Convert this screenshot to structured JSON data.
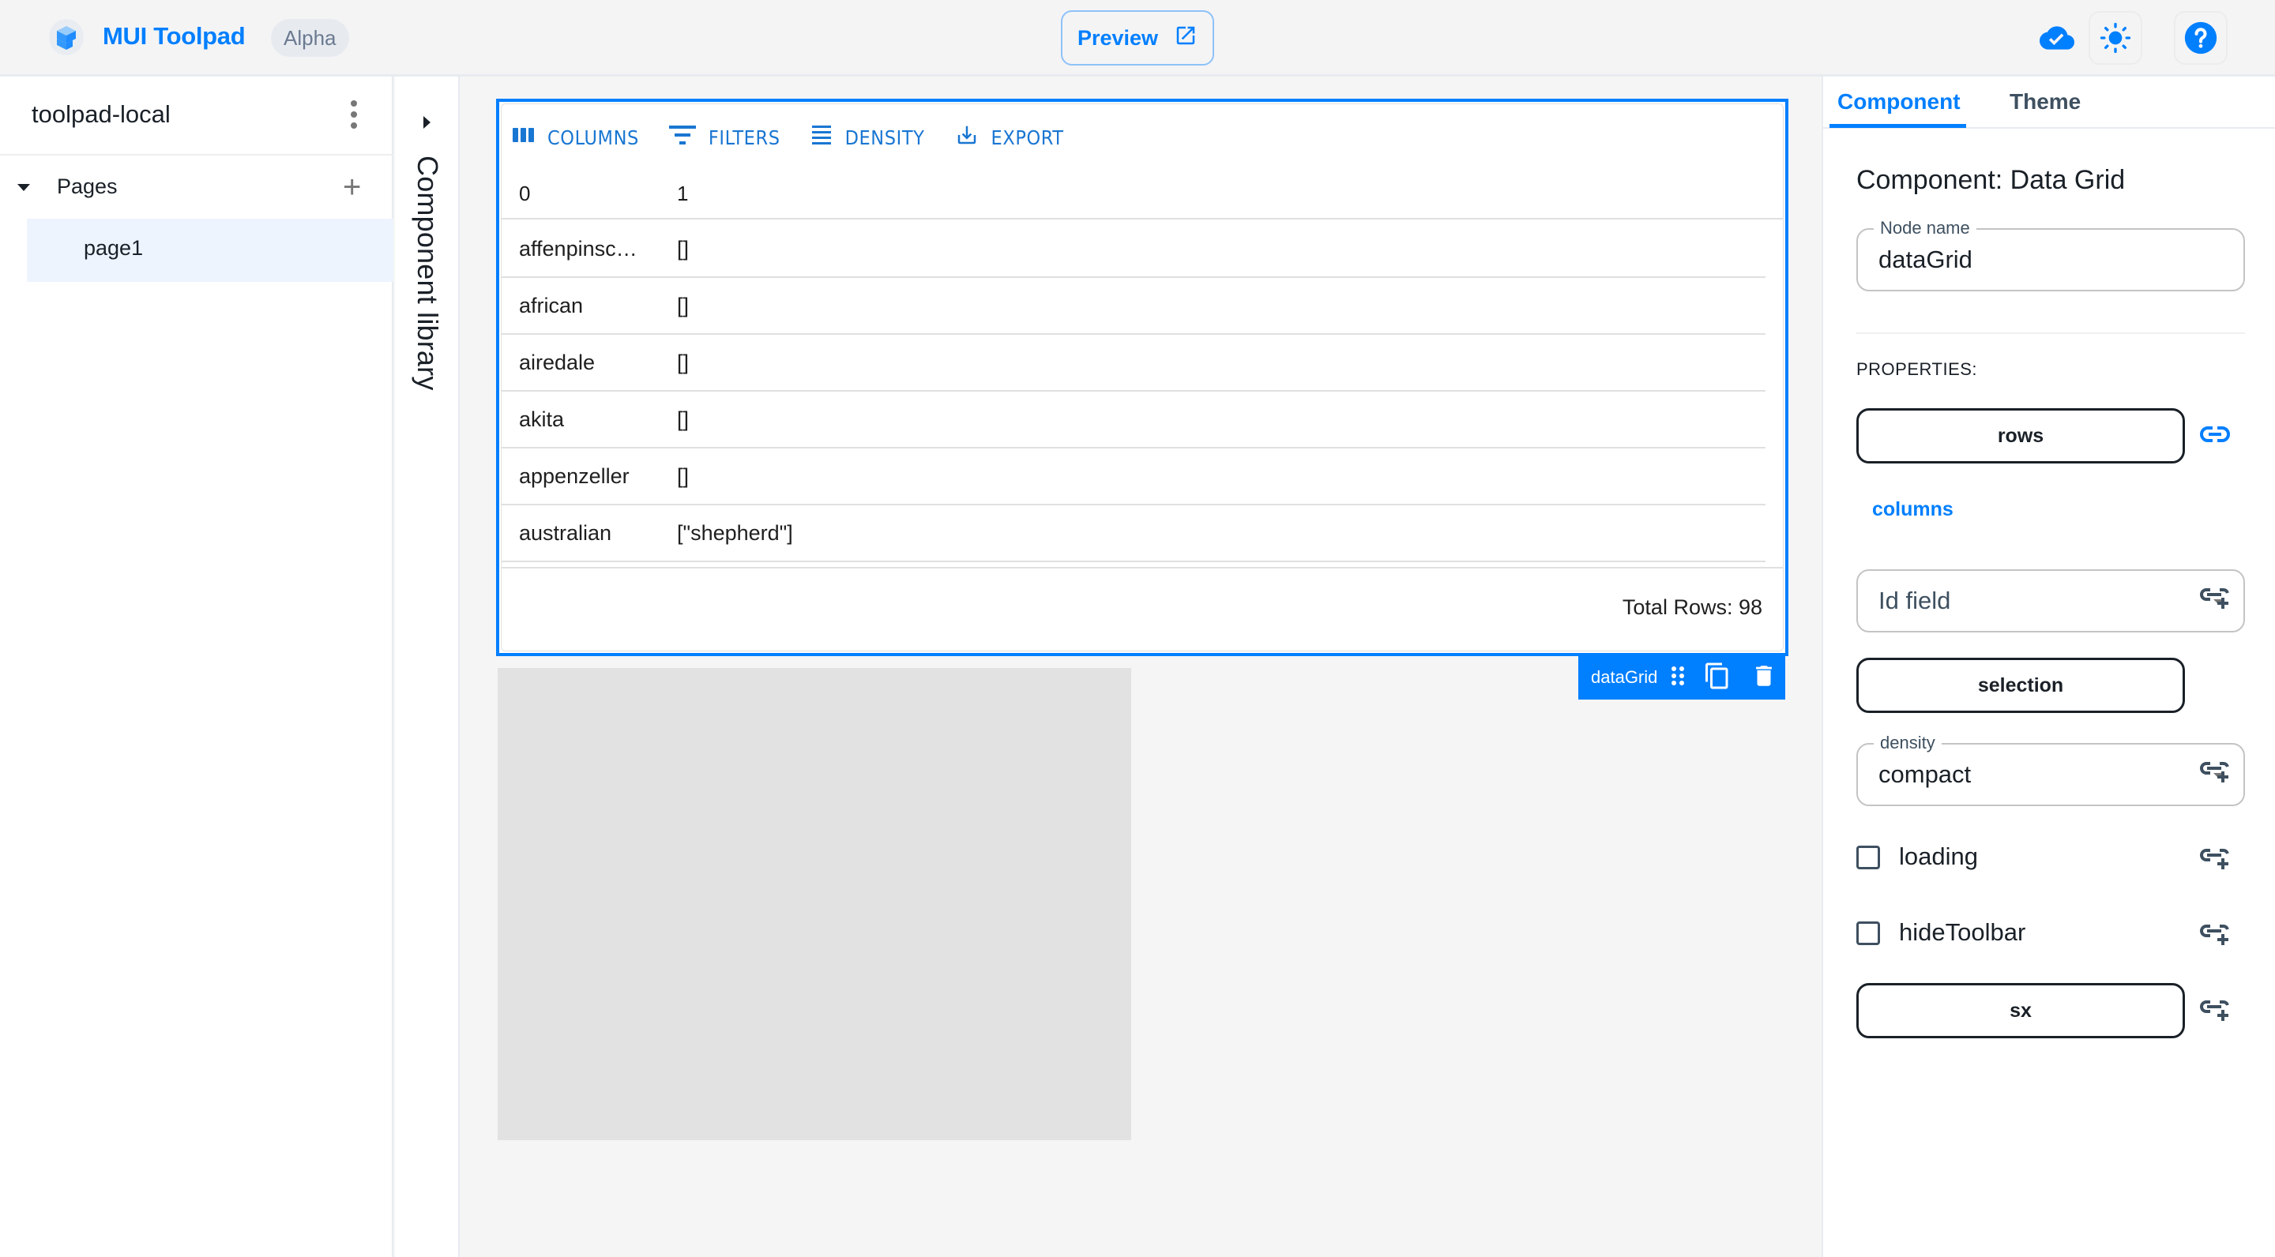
{
  "topbar": {
    "app_title": "MUI Toolpad",
    "badge": "Alpha",
    "preview_label": "Preview",
    "icons": [
      "toolpad-logo-icon",
      "cloud-done-icon",
      "light-mode-icon",
      "help-icon"
    ]
  },
  "sidebar": {
    "project_name": "toolpad-local",
    "pages_label": "Pages",
    "pages": [
      {
        "label": "page1",
        "selected": true
      }
    ]
  },
  "component_library": {
    "label": "Component library"
  },
  "canvas": {
    "data_grid": {
      "toolbar": [
        {
          "label": "COLUMNS",
          "icon": "view-column-icon"
        },
        {
          "label": "FILTERS",
          "icon": "filter-list-icon"
        },
        {
          "label": "DENSITY",
          "icon": "density-icon"
        },
        {
          "label": "EXPORT",
          "icon": "export-icon"
        }
      ],
      "columns": [
        "0",
        "1"
      ],
      "rows": [
        [
          "affenpinsc…",
          "[]"
        ],
        [
          "african",
          "[]"
        ],
        [
          "airedale",
          "[]"
        ],
        [
          "akita",
          "[]"
        ],
        [
          "appenzeller",
          "[]"
        ],
        [
          "australian",
          "[\"shepherd\"]"
        ]
      ],
      "footer": "Total Rows: 98"
    },
    "selection_tag": {
      "node_name": "dataGrid"
    }
  },
  "inspector": {
    "tabs": [
      {
        "label": "Component",
        "active": true
      },
      {
        "label": "Theme",
        "active": false
      }
    ],
    "title": "Component: Data Grid",
    "node_name": {
      "label": "Node name",
      "value": "dataGrid"
    },
    "properties_label": "PROPERTIES:",
    "props": {
      "rows": "rows",
      "columns": "columns",
      "id_field_placeholder": "Id field",
      "selection": "selection",
      "density_label": "density",
      "density_value": "compact",
      "loading": {
        "label": "loading",
        "checked": false
      },
      "hide_toolbar": {
        "label": "hideToolbar",
        "checked": false
      },
      "sx": "sx"
    }
  },
  "colors": {
    "primary": "#007fff",
    "grid_toolbar": "#1976d2",
    "text": "#1a2027",
    "placeholder_gray": "#e2e2e2"
  }
}
